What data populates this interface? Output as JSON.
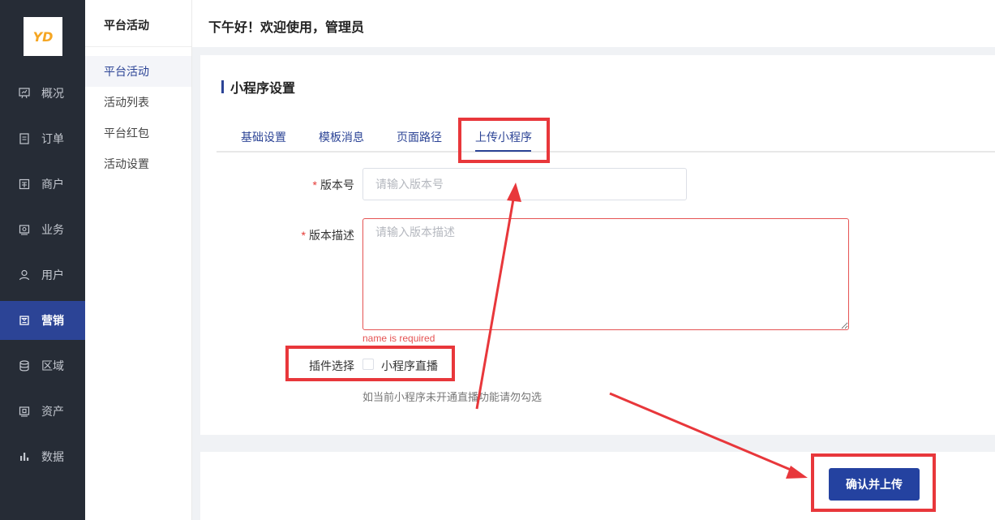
{
  "nav": {
    "logo": "YD",
    "items": [
      {
        "label": "概况",
        "icon": "chart-board-icon"
      },
      {
        "label": "订单",
        "icon": "document-list-icon"
      },
      {
        "label": "商户",
        "icon": "store-icon"
      },
      {
        "label": "业务",
        "icon": "briefcase-icon"
      },
      {
        "label": "用户",
        "icon": "user-icon"
      },
      {
        "label": "营销",
        "icon": "tag-icon"
      },
      {
        "label": "区域",
        "icon": "database-icon"
      },
      {
        "label": "资产",
        "icon": "wallet-icon"
      },
      {
        "label": "数据",
        "icon": "bar-chart-icon"
      }
    ],
    "active": "营销"
  },
  "subnav": {
    "title": "平台活动",
    "items": [
      {
        "label": "平台活动"
      },
      {
        "label": "活动列表"
      },
      {
        "label": "平台红包"
      },
      {
        "label": "活动设置"
      }
    ],
    "active": "平台活动"
  },
  "header": {
    "greeting": "下午好！欢迎使用，管理员"
  },
  "main": {
    "section_title": "小程序设置",
    "tabs": [
      {
        "label": "基础设置"
      },
      {
        "label": "模板消息"
      },
      {
        "label": "页面路径"
      },
      {
        "label": "上传小程序"
      }
    ],
    "active_tab": "上传小程序",
    "form": {
      "version": {
        "label": "版本号",
        "required_mark": "*",
        "placeholder": "请输入版本号",
        "value": ""
      },
      "description": {
        "label": "版本描述",
        "required_mark": "*",
        "placeholder": "请输入版本描述",
        "value": "",
        "error": "name is required"
      },
      "plugin": {
        "label": "插件选择",
        "option_label": "小程序直播",
        "checked": false,
        "hint": "如当前小程序未开通直播功能请勿勾选"
      }
    },
    "submit_label": "确认并上传"
  },
  "colors": {
    "nav_bg": "#262c36",
    "accent": "#2c4496",
    "annotation_red": "#e8373b",
    "error_red": "#e55353"
  }
}
